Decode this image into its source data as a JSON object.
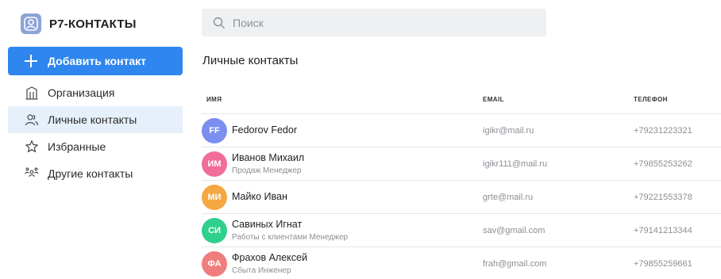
{
  "app": {
    "title": "Р7-КОНТАКТЫ",
    "logo_icon": "contacts-logo-icon",
    "accent": "#2f86ee"
  },
  "sidebar": {
    "add_button": {
      "label": "Добавить контакт",
      "icon": "plus-icon"
    },
    "items": [
      {
        "label": "Организация",
        "icon": "building-icon",
        "active": false
      },
      {
        "label": "Личные контакты",
        "icon": "people-icon",
        "active": true
      },
      {
        "label": "Избранные",
        "icon": "star-icon",
        "active": false
      },
      {
        "label": "Другие контакты",
        "icon": "group-icon",
        "active": false
      }
    ]
  },
  "search": {
    "placeholder": "Поиск",
    "value": "",
    "icon": "search-icon"
  },
  "main": {
    "title": "Личные контакты",
    "columns": {
      "name": "ИМЯ",
      "email": "EMAIL",
      "phone": "ТЕЛЕФОН"
    },
    "contacts": [
      {
        "initials": "FF",
        "name": "Fedorov Fedor",
        "role": "",
        "email": "igikr@mail.ru",
        "phone": "+79231223321",
        "color": "#7b8ff0"
      },
      {
        "initials": "ИМ",
        "name": "Иванов Михаил",
        "role": "Продаж Менеджер",
        "email": "igikr111@mail.ru",
        "phone": "+79855253262",
        "color": "#f06d9b"
      },
      {
        "initials": "МИ",
        "name": "Майко Иван",
        "role": "",
        "email": "grte@mail.ru",
        "phone": "+79221553378",
        "color": "#f5a742"
      },
      {
        "initials": "СИ",
        "name": "Савиных Игнат",
        "role": "Работы с клиентами Менеджер",
        "email": "sav@gmail.com",
        "phone": "+79141213344",
        "color": "#2fcf8c"
      },
      {
        "initials": "ФА",
        "name": "Фрахов Алексей",
        "role": "Сбыта Инженер",
        "email": "frah@gmail.com",
        "phone": "+79855259661",
        "color": "#f07d7d"
      }
    ]
  }
}
